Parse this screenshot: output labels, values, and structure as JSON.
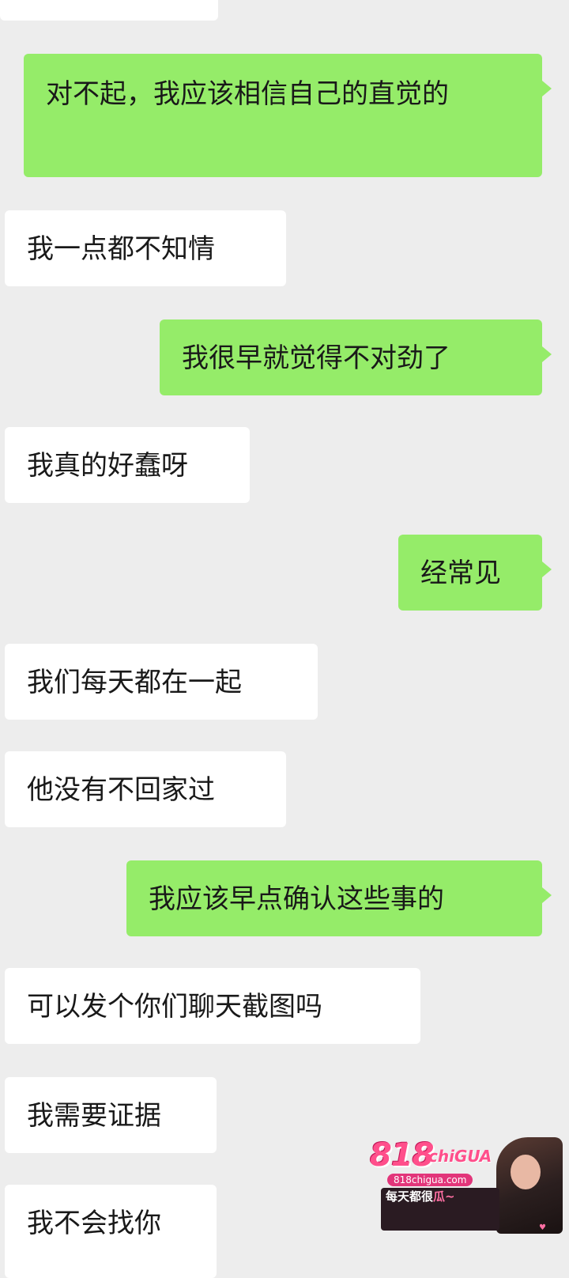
{
  "messages": [
    {
      "side": "out",
      "text": "对不起，我应该相信自己的直觉的"
    },
    {
      "side": "in",
      "text": "我一点都不知情"
    },
    {
      "side": "out",
      "text": "我很早就觉得不对劲了"
    },
    {
      "side": "in",
      "text": "我真的好蠢呀"
    },
    {
      "side": "out",
      "text": "经常见"
    },
    {
      "side": "in",
      "text": "我们每天都在一起"
    },
    {
      "side": "in",
      "text": "他没有不回家过"
    },
    {
      "side": "out",
      "text": "我应该早点确认这些事的"
    },
    {
      "side": "in",
      "text": "可以发个你们聊天截图吗"
    },
    {
      "side": "in",
      "text": "我需要证据"
    },
    {
      "side": "in",
      "text": "我不会找你"
    }
  ],
  "watermark": {
    "logo": "818",
    "logo_suffix": "chiGUA",
    "url": "818chigua.com",
    "slogan_prefix": "每天都很",
    "slogan_highlight": "瓜~"
  },
  "colors": {
    "background": "#ededed",
    "outgoing_bubble": "#95ec69",
    "incoming_bubble": "#ffffff",
    "text": "#191919"
  }
}
